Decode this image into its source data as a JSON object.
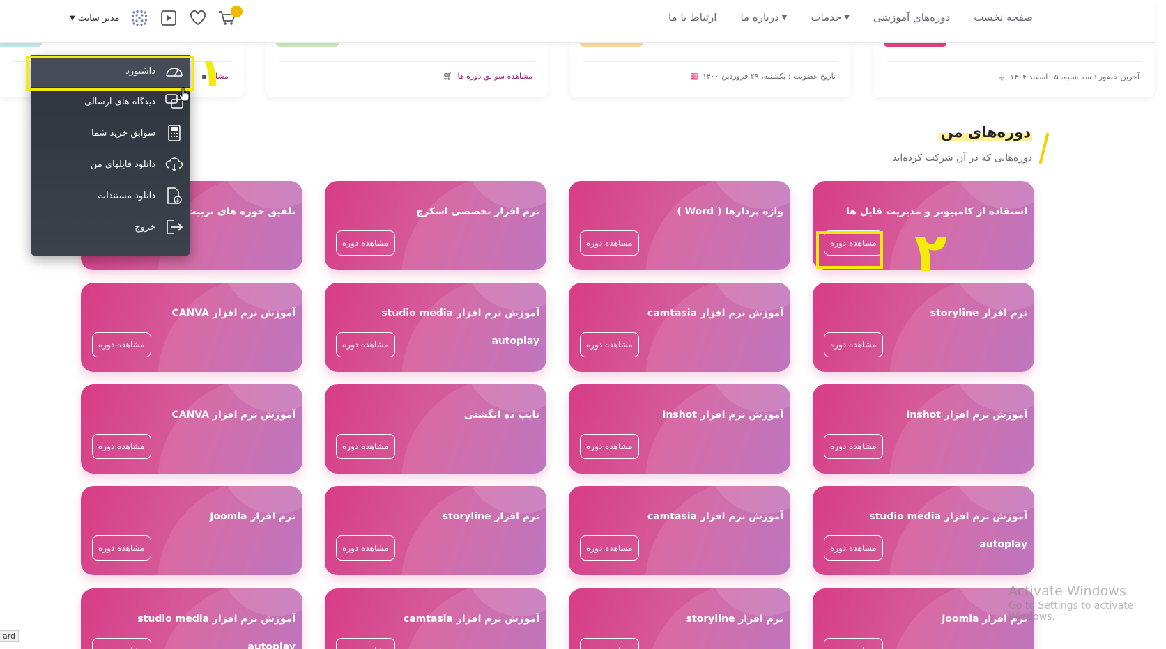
{
  "header": {
    "nav": [
      {
        "label": "صفحه نخست",
        "has_dropdown": false
      },
      {
        "label": "دوره‌های آموزشی",
        "has_dropdown": false
      },
      {
        "label": "خدمات",
        "has_dropdown": true
      },
      {
        "label": "درباره ما",
        "has_dropdown": true
      },
      {
        "label": "ارتباط با ما",
        "has_dropdown": false
      }
    ],
    "user_label": "مدیر سایت",
    "cart_count": "۰",
    "icons": [
      "grid-avatar-icon",
      "video-play-icon",
      "heart-icon",
      "cart-icon"
    ]
  },
  "stats": {
    "last_visit": "آخرین حضور : سه شنبه، ۰۵ اسفند ۱۴۰۴",
    "member_since": "تاریخ عضویت : یکشنبه، ۲۹ فروردین ۱۴۰۰",
    "order_history_link": "مشاهده سوابق دوره ها",
    "comments_link": "مشاه"
  },
  "section": {
    "title": "دوره‌های من",
    "subtitle": "دوره‌هایی که در آن شرکت کرده‌اید"
  },
  "course_button_label": "مشاهده دوره",
  "courses": [
    {
      "title": "استفاده از کامپیوتر و مدیریت فایل ها"
    },
    {
      "title": "واژه پردازها ( Word )"
    },
    {
      "title": "نرم افزار تخصصی اسکرچ"
    },
    {
      "title": "تلفیق حوزه های تربیت و یادگیری پایتون"
    },
    {
      "title": "نرم افزار storyline"
    },
    {
      "title": "آموزش نرم افزار camtasia"
    },
    {
      "title": "آموزش نرم افزار studio media autoplay"
    },
    {
      "title": "آموزش نرم افزار CANVA"
    },
    {
      "title": "آموزش نرم افزار Inshot"
    },
    {
      "title": "آموزش نرم افزار Inshot"
    },
    {
      "title": "تایپ ده انگشتی"
    },
    {
      "title": "آموزش نرم افزار CANVA"
    },
    {
      "title": "آموزش نرم افزار studio media autoplay"
    },
    {
      "title": "آموزش نرم افزار camtasia"
    },
    {
      "title": "نرم افزار storyline"
    },
    {
      "title": "نرم افزار Joomla"
    },
    {
      "title": "نرم افزار Joomla"
    },
    {
      "title": "نرم افزار storyline"
    },
    {
      "title": "آموزش نرم افزار camtasia"
    },
    {
      "title": "آموزش نرم افزار studio media autoplay"
    }
  ],
  "dropdown": [
    {
      "label": "داشبورد",
      "icon": "speedometer-icon",
      "active": true
    },
    {
      "label": "دیدگاه های ارسالی",
      "icon": "chat-bubbles-icon",
      "active": false
    },
    {
      "label": "سوابق خرید شما",
      "icon": "calculator-icon",
      "active": false
    },
    {
      "label": "دانلود فایلهای من",
      "icon": "cloud-download-icon",
      "active": false
    },
    {
      "label": "دانلود مستندات",
      "icon": "document-download-icon",
      "active": false
    },
    {
      "label": "خروج",
      "icon": "logout-icon",
      "active": false
    }
  ],
  "annotations": {
    "step1": "۱",
    "step2": "۲"
  },
  "watermark": {
    "line1": "Activate Windows",
    "line2": "Go to Settings to activate Windows."
  },
  "status_tip": "ard",
  "colors": {
    "card_start": "#d83c86",
    "card_end": "#b767b8",
    "highlight": "#f5eb0a",
    "menu_bg": "#2f343c",
    "accent_link": "#a0247a"
  }
}
